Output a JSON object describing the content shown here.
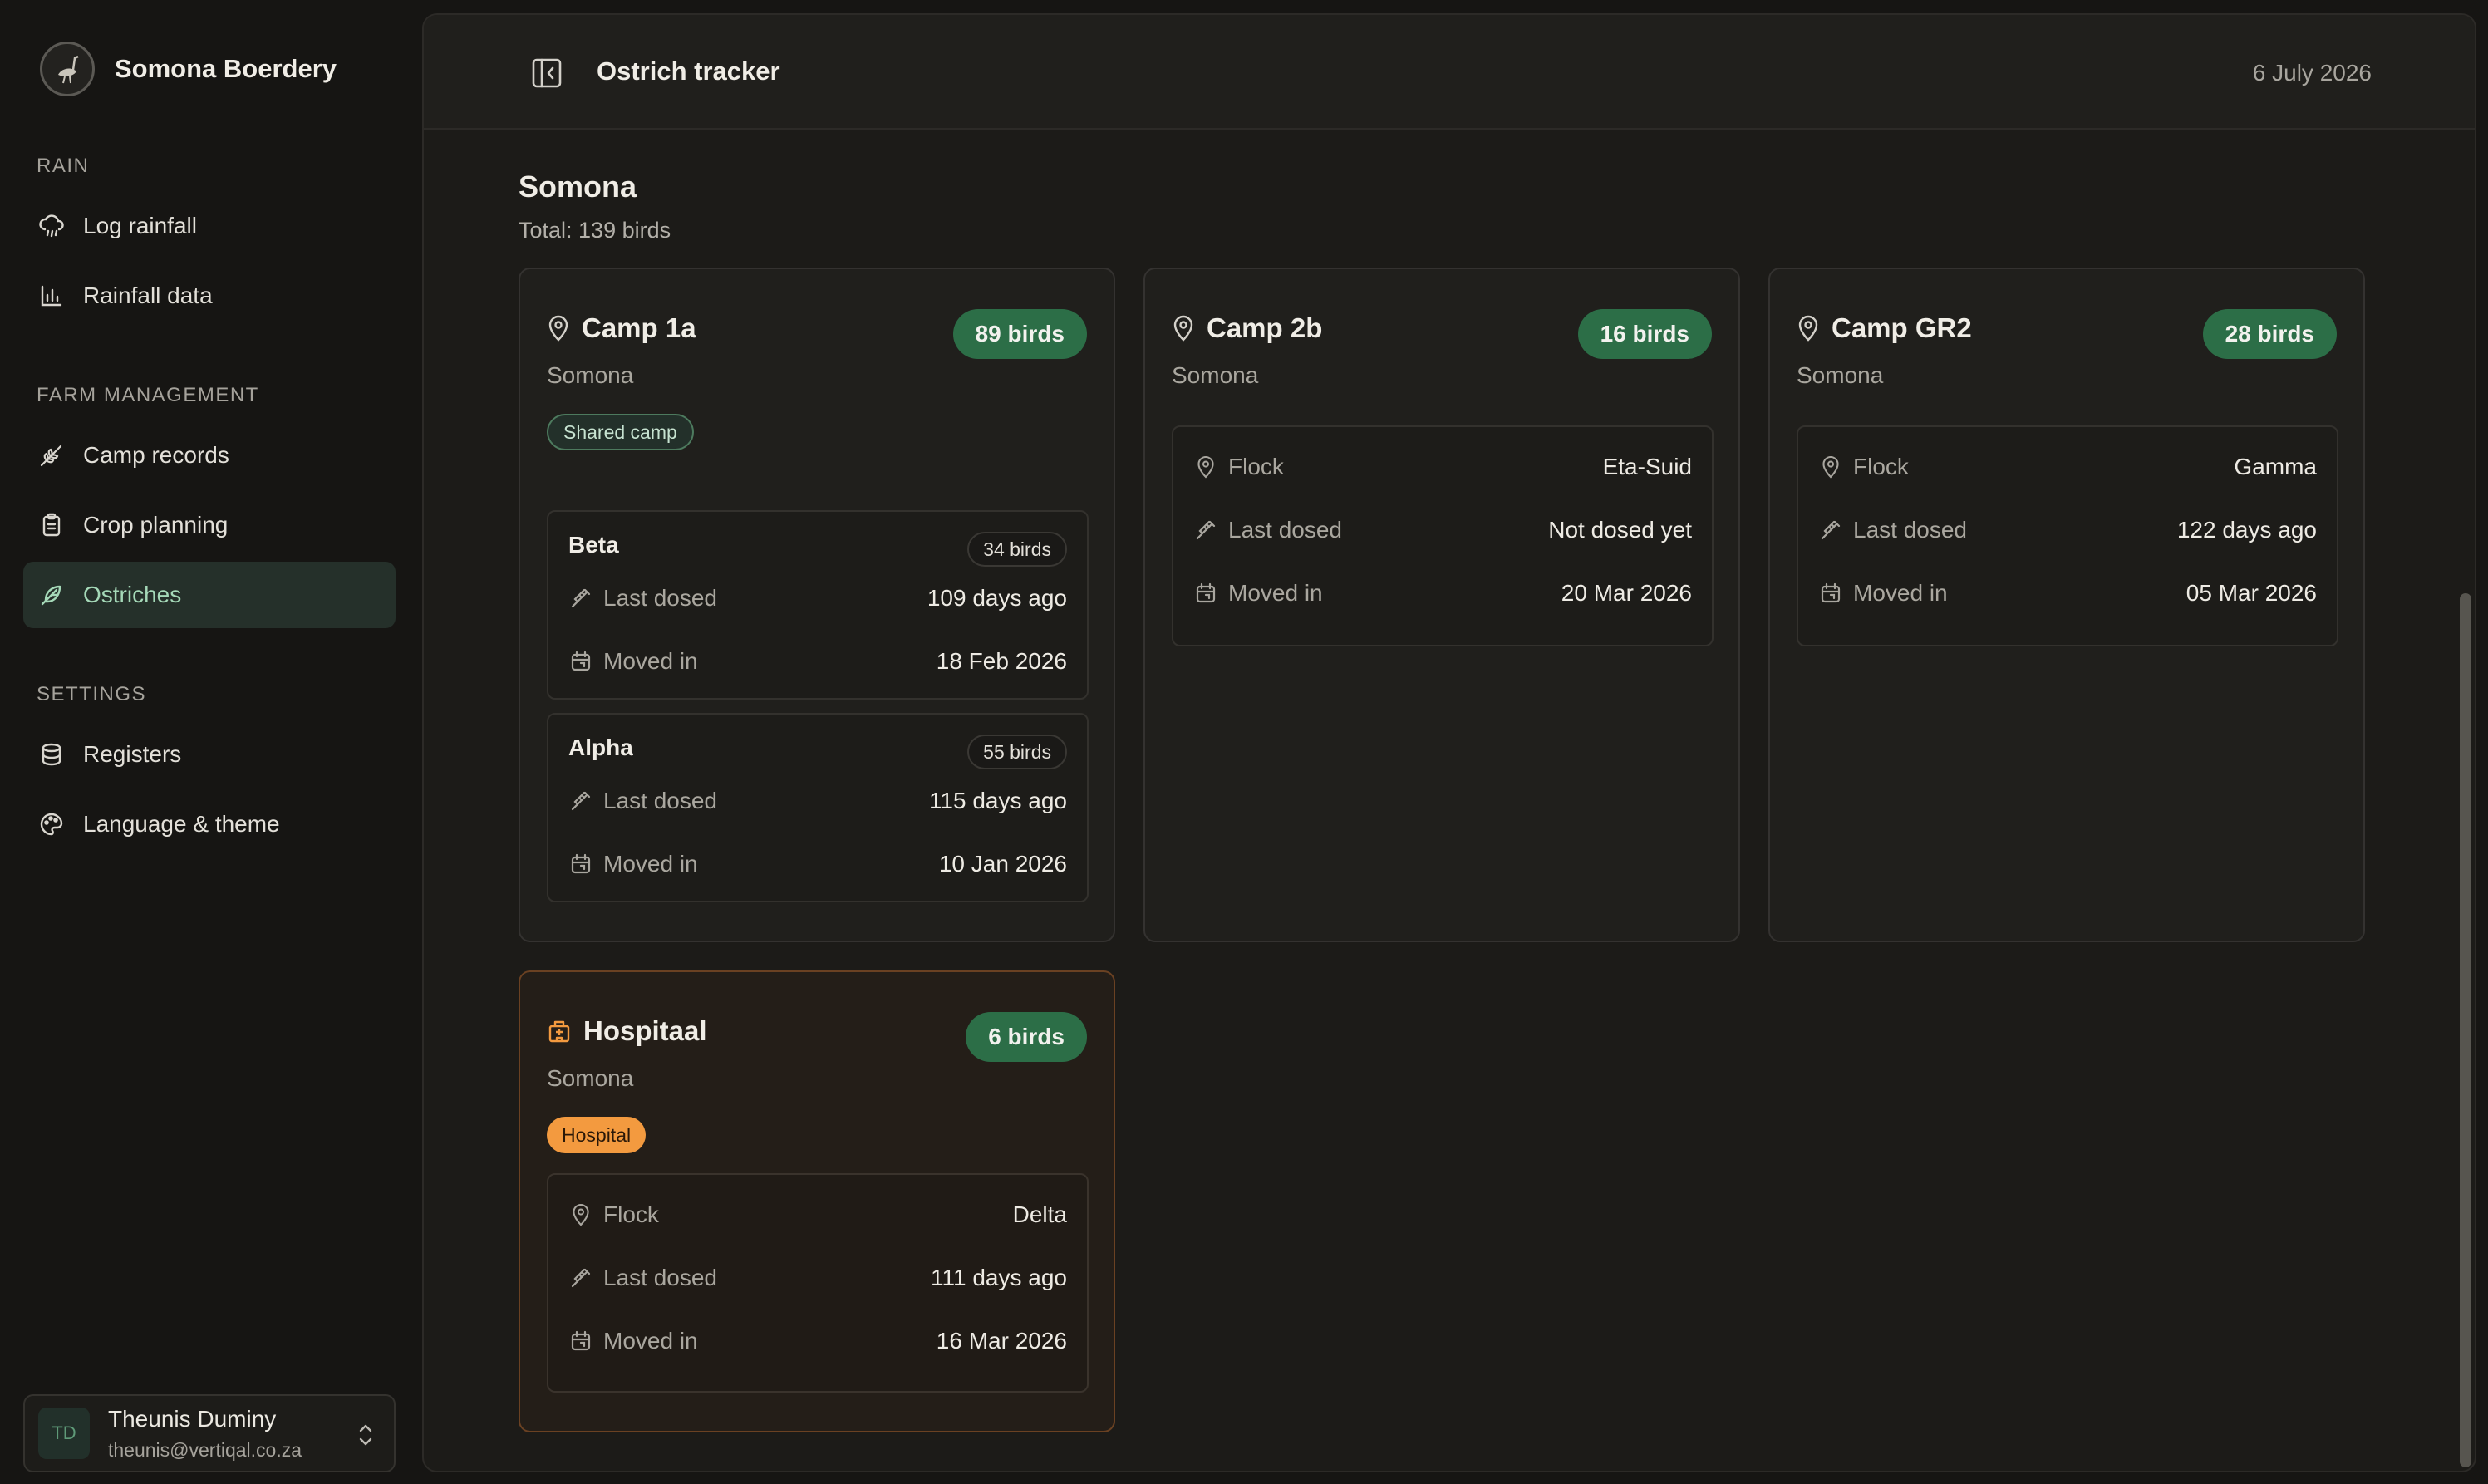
{
  "app": {
    "name": "Somona Boerdery"
  },
  "sidebar": {
    "sections": [
      {
        "title": "RAIN",
        "items": [
          {
            "label": "Log rainfall",
            "icon": "cloud-rain-icon"
          },
          {
            "label": "Rainfall data",
            "icon": "bar-chart-icon"
          }
        ]
      },
      {
        "title": "FARM MANAGEMENT",
        "items": [
          {
            "label": "Camp records",
            "icon": "wheat-icon"
          },
          {
            "label": "Crop planning",
            "icon": "clipboard-icon"
          },
          {
            "label": "Ostriches",
            "icon": "feather-icon",
            "active": true
          }
        ]
      },
      {
        "title": "SETTINGS",
        "items": [
          {
            "label": "Registers",
            "icon": "database-icon"
          },
          {
            "label": "Language & theme",
            "icon": "palette-icon"
          }
        ]
      }
    ],
    "user": {
      "initials": "TD",
      "name": "Theunis Duminy",
      "email": "theunis@vertiqal.co.za"
    }
  },
  "header": {
    "title": "Ostrich tracker",
    "date": "6 July 2026"
  },
  "farm": {
    "name": "Somona",
    "total": "Total: 139 birds"
  },
  "labels": {
    "flock": "Flock",
    "last_dosed": "Last dosed",
    "moved_in": "Moved in"
  },
  "camps": [
    {
      "name": "Camp 1a",
      "farm": "Somona",
      "birds": "89 birds",
      "tag": "Shared camp",
      "flocks": [
        {
          "name": "Beta",
          "birds": "34 birds",
          "last_dosed": "109 days ago",
          "moved_in": "18 Feb 2026"
        },
        {
          "name": "Alpha",
          "birds": "55 birds",
          "last_dosed": "115 days ago",
          "moved_in": "10 Jan 2026"
        }
      ]
    },
    {
      "name": "Camp 2b",
      "farm": "Somona",
      "birds": "16 birds",
      "flock": "Eta-Suid",
      "last_dosed": "Not dosed yet",
      "moved_in": "20 Mar 2026"
    },
    {
      "name": "Camp GR2",
      "farm": "Somona",
      "birds": "28 birds",
      "flock": "Gamma",
      "last_dosed": "122 days ago",
      "moved_in": "05 Mar 2026"
    },
    {
      "name": "Hospitaal",
      "farm": "Somona",
      "birds": "6 birds",
      "tag": "Hospital",
      "flock": "Delta",
      "last_dosed": "111 days ago",
      "moved_in": "16 Mar 2026"
    }
  ],
  "colors": {
    "accent_green": "#2c6e47",
    "hospital_orange": "#f39a3f",
    "active_nav": "#a5d9b8"
  }
}
